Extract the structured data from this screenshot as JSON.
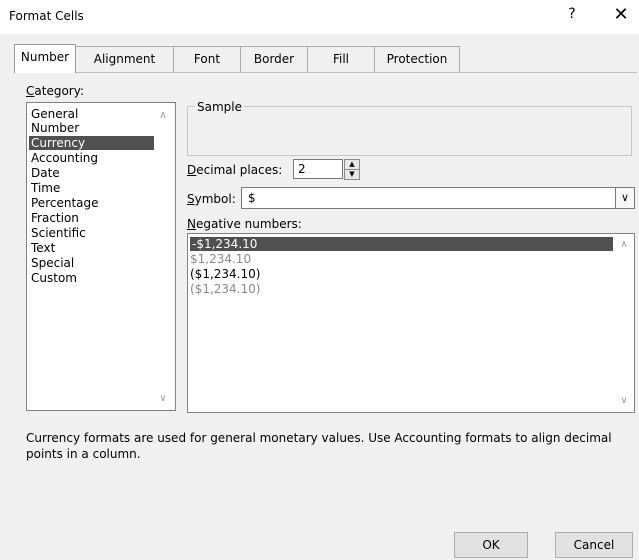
{
  "window": {
    "title": "Format Cells",
    "help_label": "?",
    "close_label": "✕"
  },
  "tabs": [
    {
      "label": "Number",
      "active": true
    },
    {
      "label": "Alignment"
    },
    {
      "label": "Font"
    },
    {
      "label": "Border"
    },
    {
      "label": "Fill"
    },
    {
      "label": "Protection"
    }
  ],
  "category": {
    "label_first": "C",
    "label_rest": "ategory:",
    "items": [
      "General",
      "Number",
      "Currency",
      "Accounting",
      "Date",
      "Time",
      "Percentage",
      "Fraction",
      "Scientific",
      "Text",
      "Special",
      "Custom"
    ],
    "selected": "Currency"
  },
  "sample": {
    "label": "Sample",
    "value": ""
  },
  "decimal": {
    "label_first": "D",
    "label_rest": "ecimal places:",
    "value": "2"
  },
  "symbol": {
    "label_first": "S",
    "label_rest": "ymbol:",
    "value": "$"
  },
  "negative": {
    "label_first": "N",
    "label_rest": "egative numbers:",
    "items": [
      "-$1,234.10",
      "$1,234.10",
      "($1,234.10)",
      "($1,234.10)"
    ],
    "selected_index": 0
  },
  "description": "Currency formats are used for general monetary values.  Use Accounting formats to align decimal points in a column.",
  "buttons": {
    "ok": "OK",
    "cancel": "Cancel"
  },
  "colors": {
    "selection": "#505050",
    "negative_red_gray": "#8a8a8a"
  }
}
